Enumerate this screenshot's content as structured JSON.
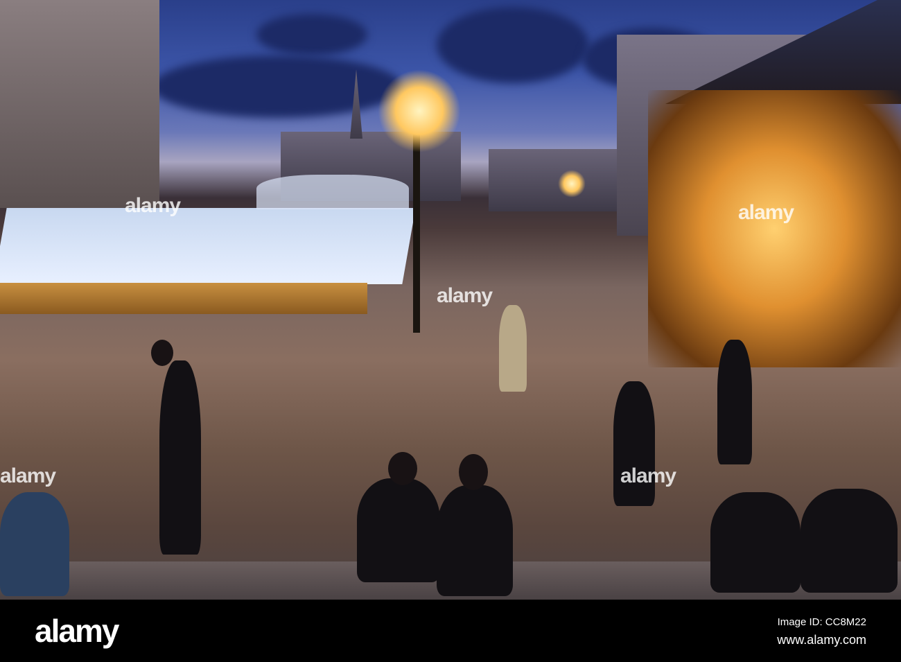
{
  "photo": {
    "description_alt": "",
    "watermark": "alamy"
  },
  "footer": {
    "logo": "alamy",
    "image_id": "Image ID: CC8M22",
    "website": "www.alamy.com"
  }
}
